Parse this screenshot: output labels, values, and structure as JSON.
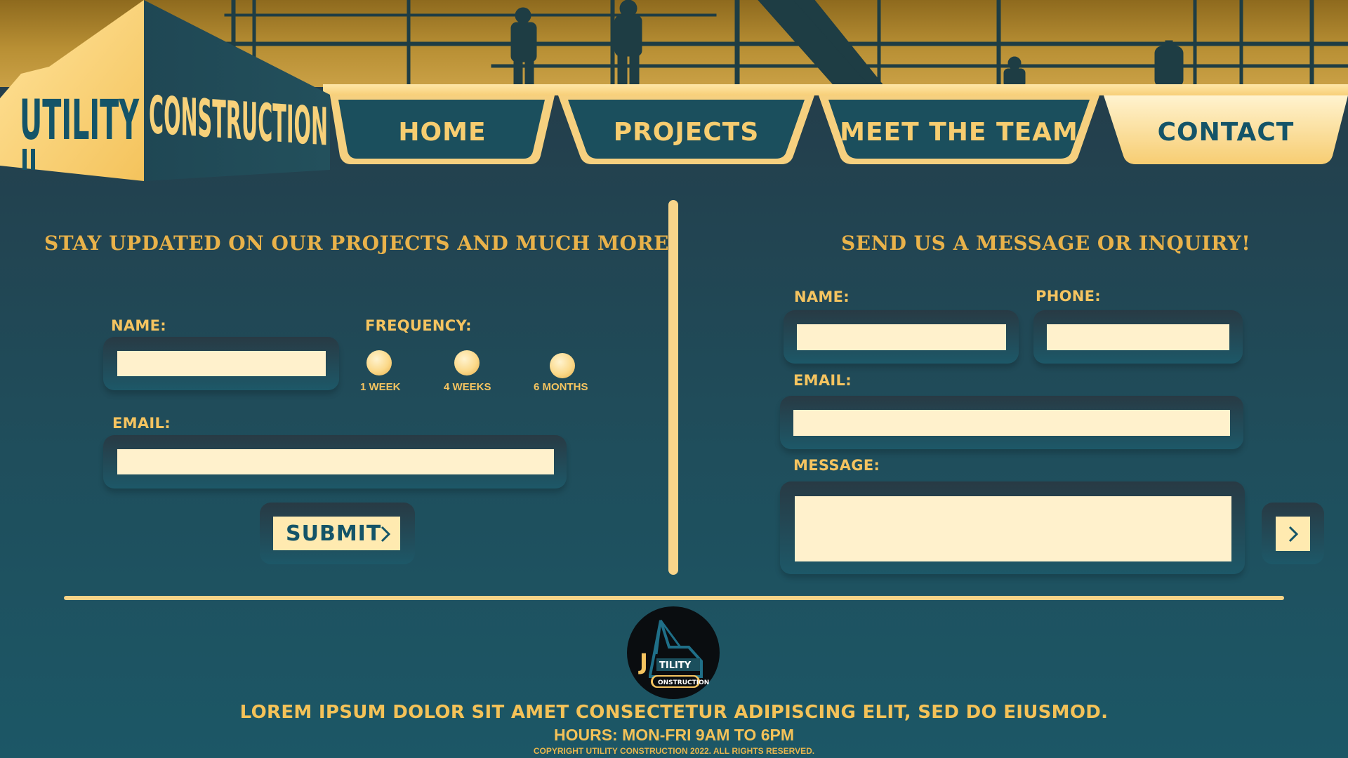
{
  "brand": {
    "name_part1": "UTILITY",
    "name_part2": "CONSTRUCTION",
    "colors": {
      "navy": "#145468",
      "gold": "#f5c460",
      "cream": "#fff1cc"
    }
  },
  "nav": {
    "items": [
      {
        "label": "HOME",
        "active": false
      },
      {
        "label": "PROJECTS",
        "active": false
      },
      {
        "label": "MEET THE TEAM",
        "active": false
      },
      {
        "label": "CONTACT",
        "active": true
      }
    ]
  },
  "newsletter": {
    "title": "STAY UPDATED ON OUR PROJECTS AND MUCH MORE!",
    "name_label": "NAME:",
    "name_value": "",
    "email_label": "EMAIL:",
    "email_value": "",
    "frequency_label": "FREQUENCY:",
    "frequency_options": [
      "1 WEEK",
      "4 WEEKS",
      "6 MONTHS"
    ],
    "submit_label": "SUBMIT",
    "submit_icon": "chevron-right-icon"
  },
  "inquiry": {
    "title": "SEND US A MESSAGE OR INQUIRY!",
    "name_label": "NAME:",
    "name_value": "",
    "phone_label": "PHONE:",
    "phone_value": "",
    "email_label": "EMAIL:",
    "email_value": "",
    "message_label": "MESSAGE:",
    "message_value": "",
    "send_icon": "chevron-right-icon"
  },
  "footer": {
    "logo_text_main": "TILITY",
    "logo_text_sub": "ONSTRUCTION",
    "tagline": "LOREM IPSUM DOLOR SIT AMET CONSECTETUR ADIPISCING ELIT, SED DO EIUSMOD.",
    "hours": "HOURS:  MON-FRI 9AM TO 6PM",
    "copyright": "COPYRIGHT UTILITY CONSTRUCTION 2022. ALL RIGHTS RESERVED."
  }
}
